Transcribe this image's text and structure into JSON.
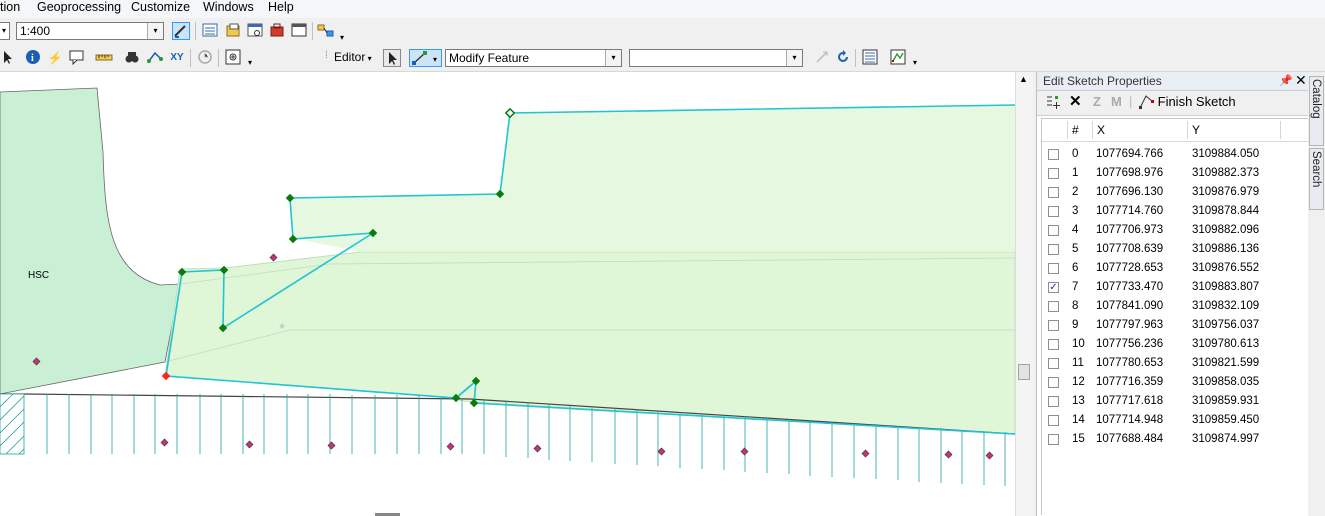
{
  "menu": [
    "tion",
    "Geoprocessing",
    "Customize",
    "Windows",
    "Help"
  ],
  "toolbar1": {
    "scale_value": "1:400"
  },
  "toolbar2": {
    "editor_label": "Editor",
    "task_value": "Modify Feature",
    "target_value": ""
  },
  "map": {
    "polygon_label": "HSC"
  },
  "panel": {
    "title": "Edit Sketch Properties",
    "finish_label": "Finish Sketch",
    "z_label": "Z",
    "m_label": "M",
    "headers": {
      "num": "#",
      "x": "X",
      "y": "Y"
    },
    "rows": [
      {
        "n": "0",
        "x": "1077694.766",
        "y": "3109884.050",
        "checked": false
      },
      {
        "n": "1",
        "x": "1077698.976",
        "y": "3109882.373",
        "checked": false
      },
      {
        "n": "2",
        "x": "1077696.130",
        "y": "3109876.979",
        "checked": false
      },
      {
        "n": "3",
        "x": "1077714.760",
        "y": "3109878.844",
        "checked": false
      },
      {
        "n": "4",
        "x": "1077706.973",
        "y": "3109882.096",
        "checked": false
      },
      {
        "n": "5",
        "x": "1077708.639",
        "y": "3109886.136",
        "checked": false
      },
      {
        "n": "6",
        "x": "1077728.653",
        "y": "3109876.552",
        "checked": false
      },
      {
        "n": "7",
        "x": "1077733.470",
        "y": "3109883.807",
        "checked": true
      },
      {
        "n": "8",
        "x": "1077841.090",
        "y": "3109832.109",
        "checked": false
      },
      {
        "n": "9",
        "x": "1077797.963",
        "y": "3109756.037",
        "checked": false
      },
      {
        "n": "10",
        "x": "1077756.236",
        "y": "3109780.613",
        "checked": false
      },
      {
        "n": "11",
        "x": "1077780.653",
        "y": "3109821.599",
        "checked": false
      },
      {
        "n": "12",
        "x": "1077716.359",
        "y": "3109858.035",
        "checked": false
      },
      {
        "n": "13",
        "x": "1077717.618",
        "y": "3109859.931",
        "checked": false
      },
      {
        "n": "14",
        "x": "1077714.948",
        "y": "3109859.450",
        "checked": false
      },
      {
        "n": "15",
        "x": "1077688.484",
        "y": "3109874.997",
        "checked": false
      }
    ]
  },
  "side_tabs": [
    "Catalog",
    "Search"
  ],
  "colors": {
    "sketch": "#20c4d4",
    "vertex": "#0c7a0c",
    "selected_vertex": "#ff2020",
    "polygon_fill": "#dff7d6",
    "hsc_fill": "#c9efd4",
    "point": "#c8327a"
  }
}
